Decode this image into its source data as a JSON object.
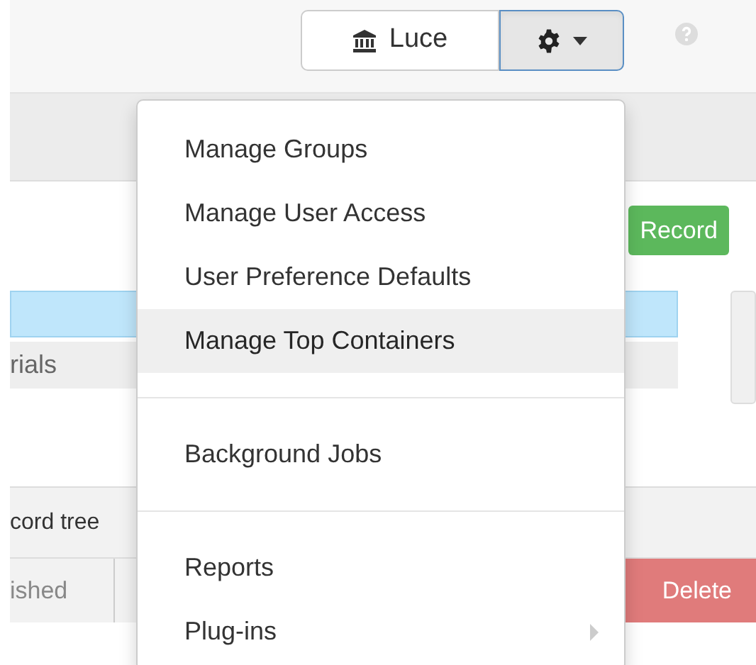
{
  "header": {
    "repository_button": "Luce",
    "settings_open": true
  },
  "toolbar": {
    "record_button": "Record"
  },
  "tree_rows": [
    {
      "selected": true
    },
    {
      "label": "rials",
      "selected": false
    }
  ],
  "record_tree_label": "cord tree",
  "footer": {
    "left_button": "ished",
    "delete_button": "Delete"
  },
  "menu": {
    "sections": [
      [
        {
          "label": "Manage Groups",
          "highlighted": false
        },
        {
          "label": "Manage User Access",
          "highlighted": false
        },
        {
          "label": "User Preference Defaults",
          "highlighted": false
        },
        {
          "label": "Manage Top Containers",
          "highlighted": true
        }
      ],
      [
        {
          "label": "Background Jobs",
          "highlighted": false
        }
      ],
      [
        {
          "label": "Reports",
          "highlighted": false
        },
        {
          "label": "Plug-ins",
          "highlighted": false,
          "submenu": true
        }
      ]
    ]
  }
}
